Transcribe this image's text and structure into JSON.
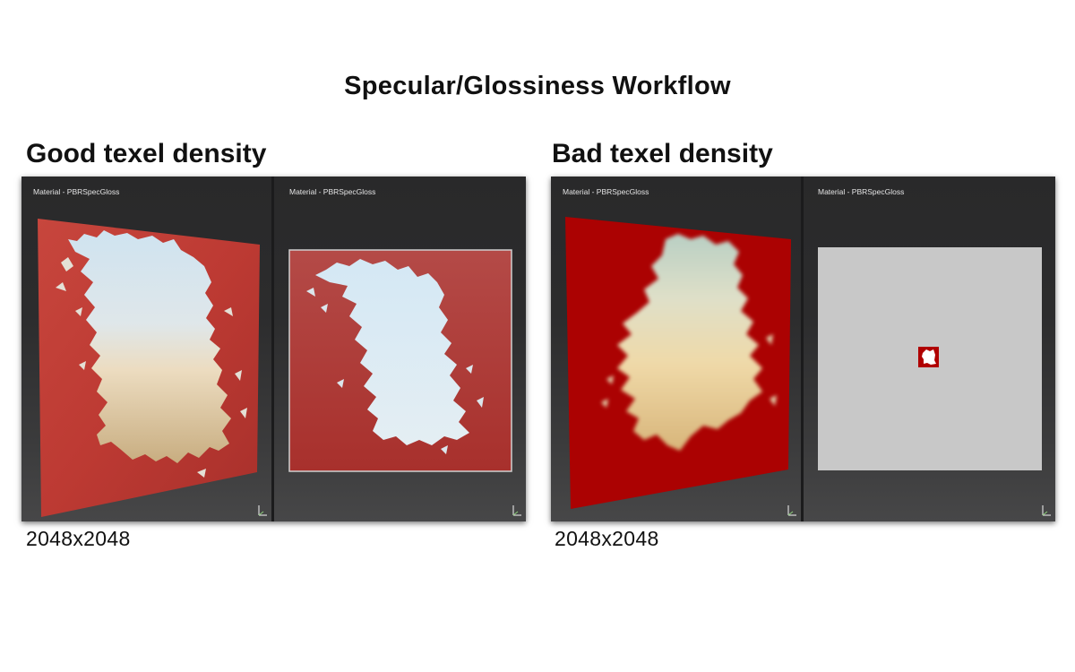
{
  "title": "Specular/Glossiness Workflow",
  "sections": [
    {
      "heading": "Good texel density",
      "resolution": "2048x2048",
      "viewports": [
        {
          "header": "Material - PBRSpecGloss",
          "view": "3d"
        },
        {
          "header": "Material - PBRSpecGloss",
          "view": "uv"
        }
      ]
    },
    {
      "heading": "Bad texel density",
      "resolution": "2048x2048",
      "viewports": [
        {
          "header": "Material - PBRSpecGloss",
          "view": "3d"
        },
        {
          "header": "Material - PBRSpecGloss",
          "view": "uv"
        }
      ]
    }
  ],
  "icons": {
    "axis": "axis-gizmo-icon"
  },
  "colors": {
    "good_red": "#c13b35",
    "bad_red": "#aa0000",
    "uv_canvas": "#c8c8c8",
    "viewport_bg": "#2b2b2c"
  }
}
